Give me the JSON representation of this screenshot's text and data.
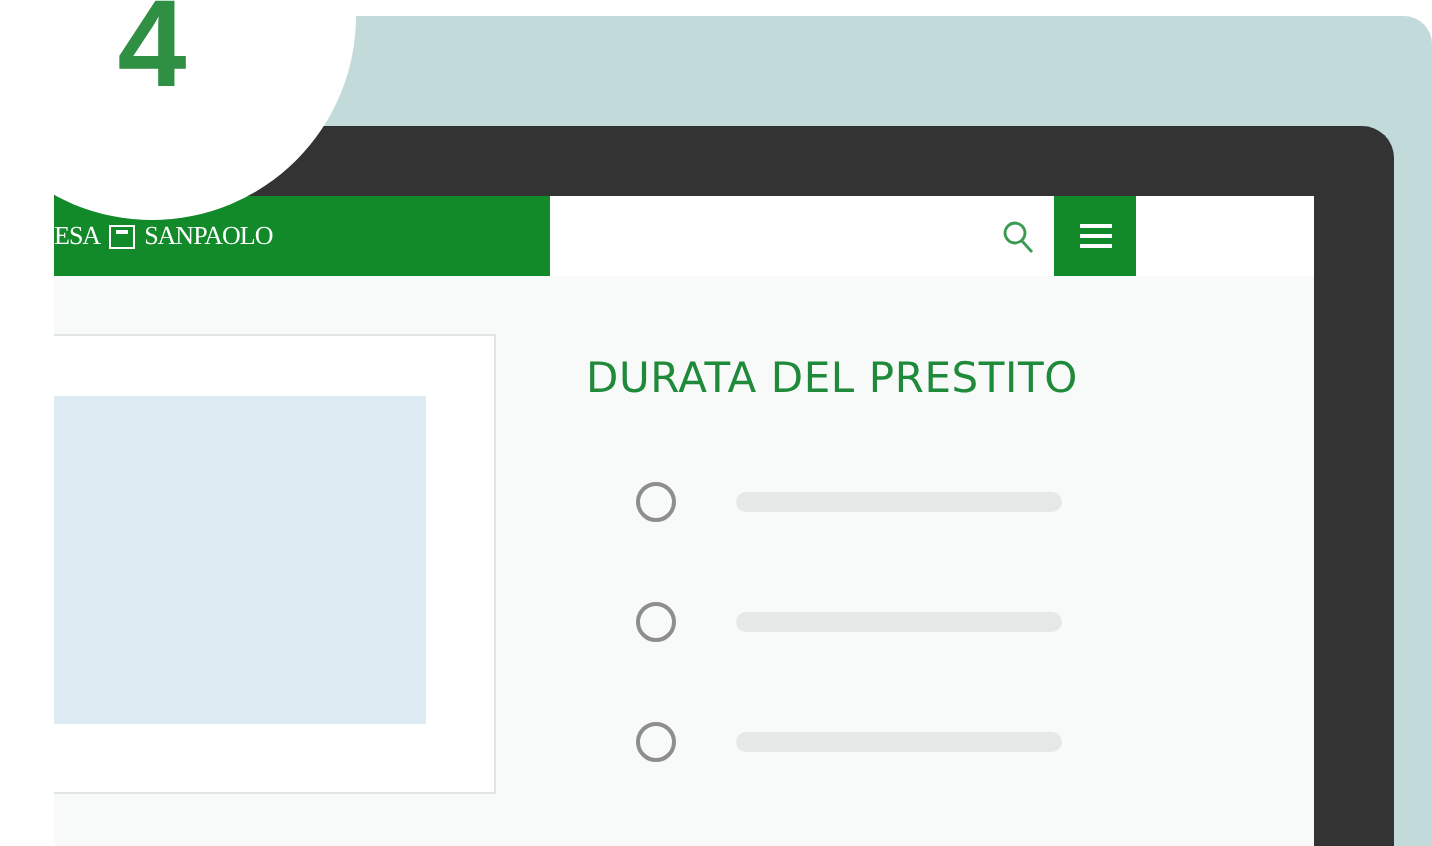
{
  "step_badge": {
    "number": "4"
  },
  "header": {
    "logo_left": "ESA",
    "logo_right": "SANPAOLO"
  },
  "section": {
    "title": "DURATA DEL PRESTITO"
  },
  "options": [
    {
      "selected": false
    },
    {
      "selected": false
    },
    {
      "selected": false
    }
  ]
}
